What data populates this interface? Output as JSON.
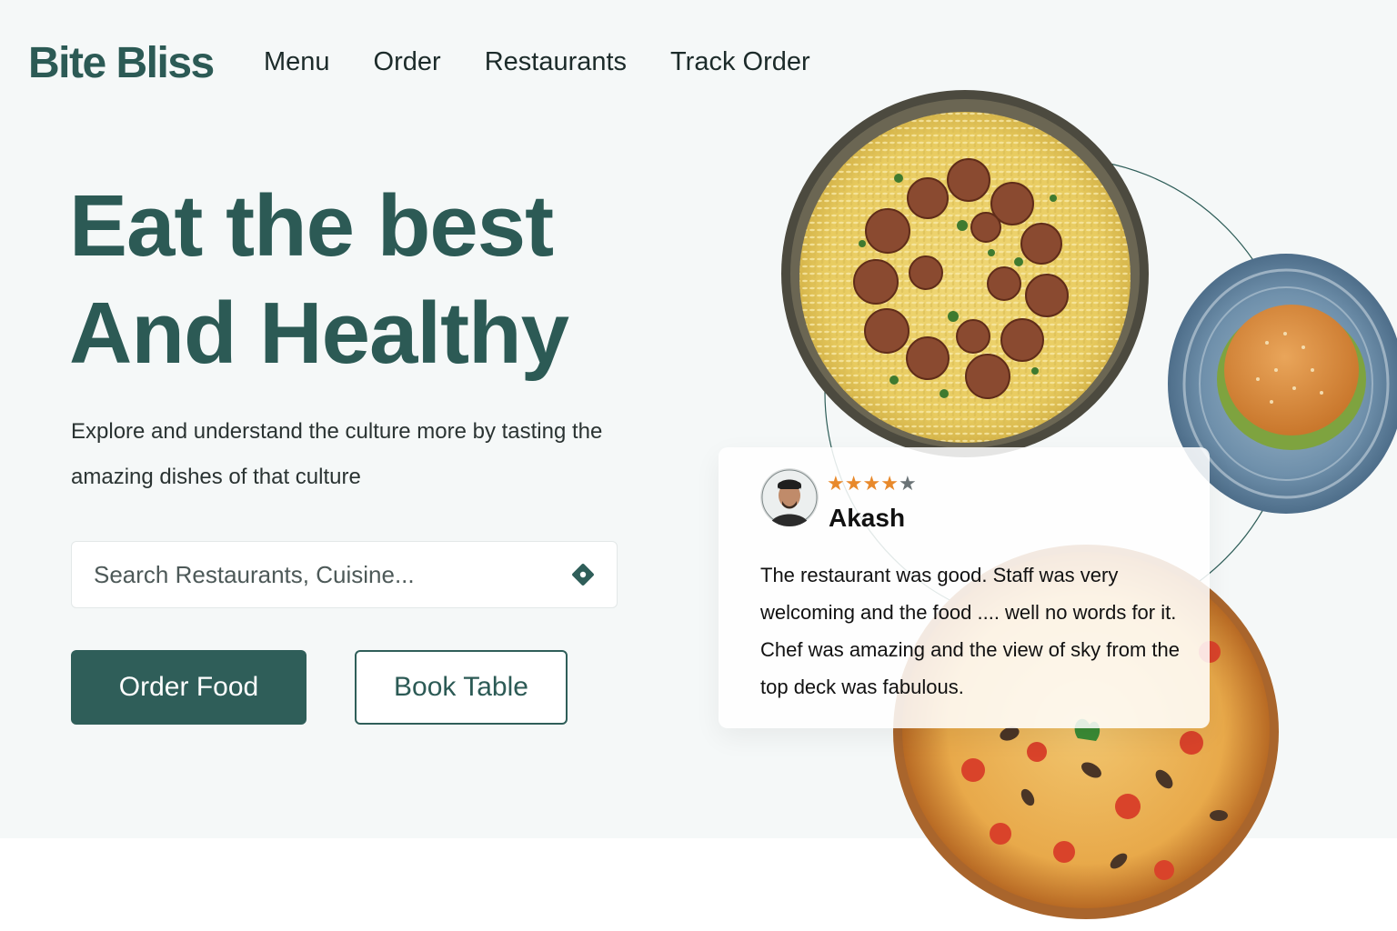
{
  "brand": {
    "name": "Bite Bliss",
    "color": "#2c5a55"
  },
  "nav": {
    "items": [
      "Menu",
      "Order",
      "Restaurants",
      "Track Order"
    ]
  },
  "hero": {
    "headline_line1": "Eat the best",
    "headline_line2": "And Healthy",
    "subtitle": "Explore and understand the culture more by tasting the amazing dishes of that culture"
  },
  "search": {
    "placeholder": "Search Restaurants, Cuisine...",
    "icon": "location-icon"
  },
  "actions": {
    "primary_label": "Order Food",
    "secondary_label": "Book Table"
  },
  "dishes": [
    "rice-bowl",
    "burger-plate",
    "pizza"
  ],
  "review": {
    "name": "Akash",
    "rating": 4,
    "max_rating": 5,
    "text": "The restaurant was good. Staff was very welcoming and the food .... well no words for it. Chef was amazing and the view of sky from the top deck was fabulous."
  },
  "colors": {
    "accent": "#2f5e59",
    "star": "#e8892b",
    "hero_bg": "#f5f8f8"
  }
}
